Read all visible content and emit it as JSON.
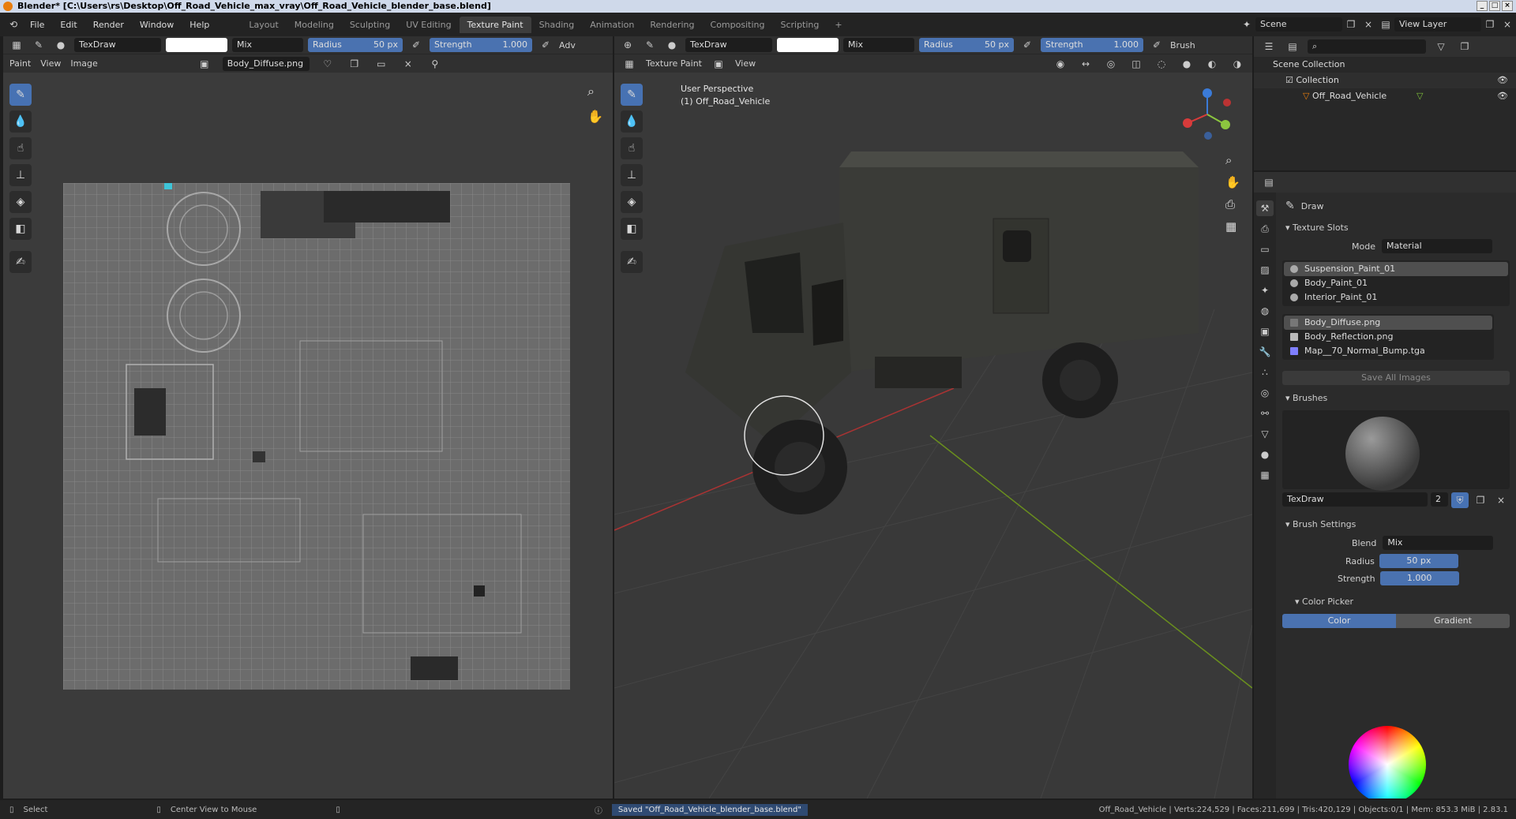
{
  "window": {
    "title": "Blender* [C:\\Users\\rs\\Desktop\\Off_Road_Vehicle_max_vray\\Off_Road_Vehicle_blender_base.blend]"
  },
  "menu": [
    "File",
    "Edit",
    "Render",
    "Window",
    "Help"
  ],
  "workspaces": [
    "Layout",
    "Modeling",
    "Sculpting",
    "UV Editing",
    "Texture Paint",
    "Shading",
    "Animation",
    "Rendering",
    "Compositing",
    "Scripting"
  ],
  "scene": {
    "label": "Scene",
    "view_layer": "View Layer"
  },
  "image_editor": {
    "header": {
      "brush": "TexDraw",
      "blend": "Mix",
      "radius_label": "Radius",
      "radius": "50 px",
      "strength_label": "Strength",
      "strength": "1.000",
      "advanced": "Adv"
    },
    "menus": [
      "Paint",
      "View",
      "Image"
    ],
    "image_name": "Body_Diffuse.png"
  },
  "viewport": {
    "header": {
      "brush": "TexDraw",
      "blend": "Mix",
      "radius_label": "Radius",
      "radius": "50 px",
      "strength_label": "Strength",
      "strength": "1.000",
      "brush_menu": "Brush"
    },
    "mode": "Texture Paint",
    "view_menu": "View",
    "overlay_line1": "User Perspective",
    "overlay_line2": "(1) Off_Road_Vehicle"
  },
  "outliner": {
    "scene_collection": "Scene Collection",
    "collection": "Collection",
    "object": "Off_Road_Vehicle"
  },
  "properties": {
    "tool": "Draw",
    "texture_slots": {
      "title": "Texture Slots",
      "mode_label": "Mode",
      "mode": "Material",
      "materials": [
        "Suspension_Paint_01",
        "Body_Paint_01",
        "Interior_Paint_01"
      ],
      "images": [
        "Body_Diffuse.png",
        "Body_Reflection.png",
        "Map__70_Normal_Bump.tga"
      ],
      "save_all": "Save All Images"
    },
    "brushes": {
      "title": "Brushes",
      "name": "TexDraw",
      "users": "2"
    },
    "brush_settings": {
      "title": "Brush Settings",
      "blend_label": "Blend",
      "blend": "Mix",
      "radius_label": "Radius",
      "radius": "50 px",
      "strength_label": "Strength",
      "strength": "1.000"
    },
    "color_picker": {
      "title": "Color Picker",
      "tab_color": "Color",
      "tab_gradient": "Gradient"
    }
  },
  "status": {
    "select": "Select",
    "center": "Center View to Mouse",
    "saved": "Saved \"Off_Road_Vehicle_blender_base.blend\"",
    "stats": "Off_Road_Vehicle | Verts:224,529 | Faces:211,699 | Tris:420,129 | Objects:0/1 | Mem: 853.3 MiB | 2.83.1"
  },
  "colors": {
    "accent": "#4772b3",
    "header": "#303030",
    "area": "#3b3b3b"
  }
}
